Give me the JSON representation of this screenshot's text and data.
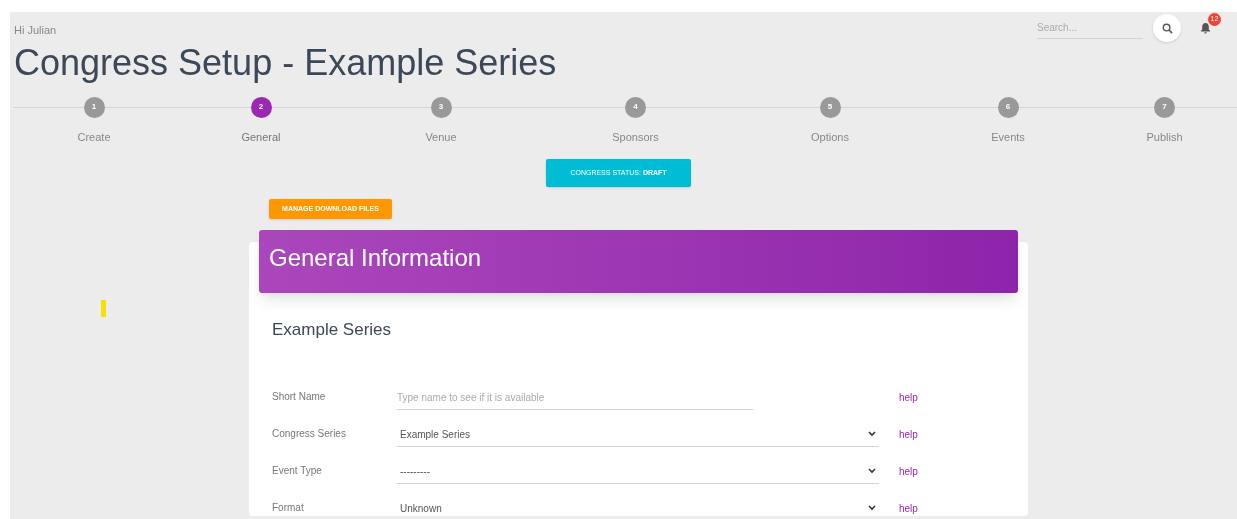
{
  "greeting": "Hi Julian",
  "page_title": "Congress Setup - Example Series",
  "search": {
    "placeholder": "Search..."
  },
  "notifications": {
    "count": "12"
  },
  "steps": [
    {
      "number": "1",
      "label": "Create",
      "selected": false
    },
    {
      "number": "2",
      "label": "General",
      "selected": true
    },
    {
      "number": "3",
      "label": "Venue",
      "selected": false
    },
    {
      "number": "4",
      "label": "Sponsors",
      "selected": false
    },
    {
      "number": "5",
      "label": "Options",
      "selected": false
    },
    {
      "number": "6",
      "label": "Events",
      "selected": false
    },
    {
      "number": "7",
      "label": "Publish",
      "selected": false
    }
  ],
  "status_button": "CONGRESS STATUS: **DRAFT**",
  "manage_button": "MANAGE DOWNLOAD FILES",
  "card": {
    "header": "General Information",
    "subtitle": "Example Series",
    "fields": [
      {
        "kind": "text",
        "label": "Short Name",
        "placeholder": "Type name to see if it is available",
        "help": "help"
      },
      {
        "kind": "select",
        "label": "Congress Series",
        "value": "Example Series",
        "help": "help"
      },
      {
        "kind": "select",
        "label": "Event Type",
        "value": "---------",
        "help": "help"
      },
      {
        "kind": "select",
        "label": "Format",
        "value": "Unknown",
        "help": "help"
      }
    ]
  }
}
